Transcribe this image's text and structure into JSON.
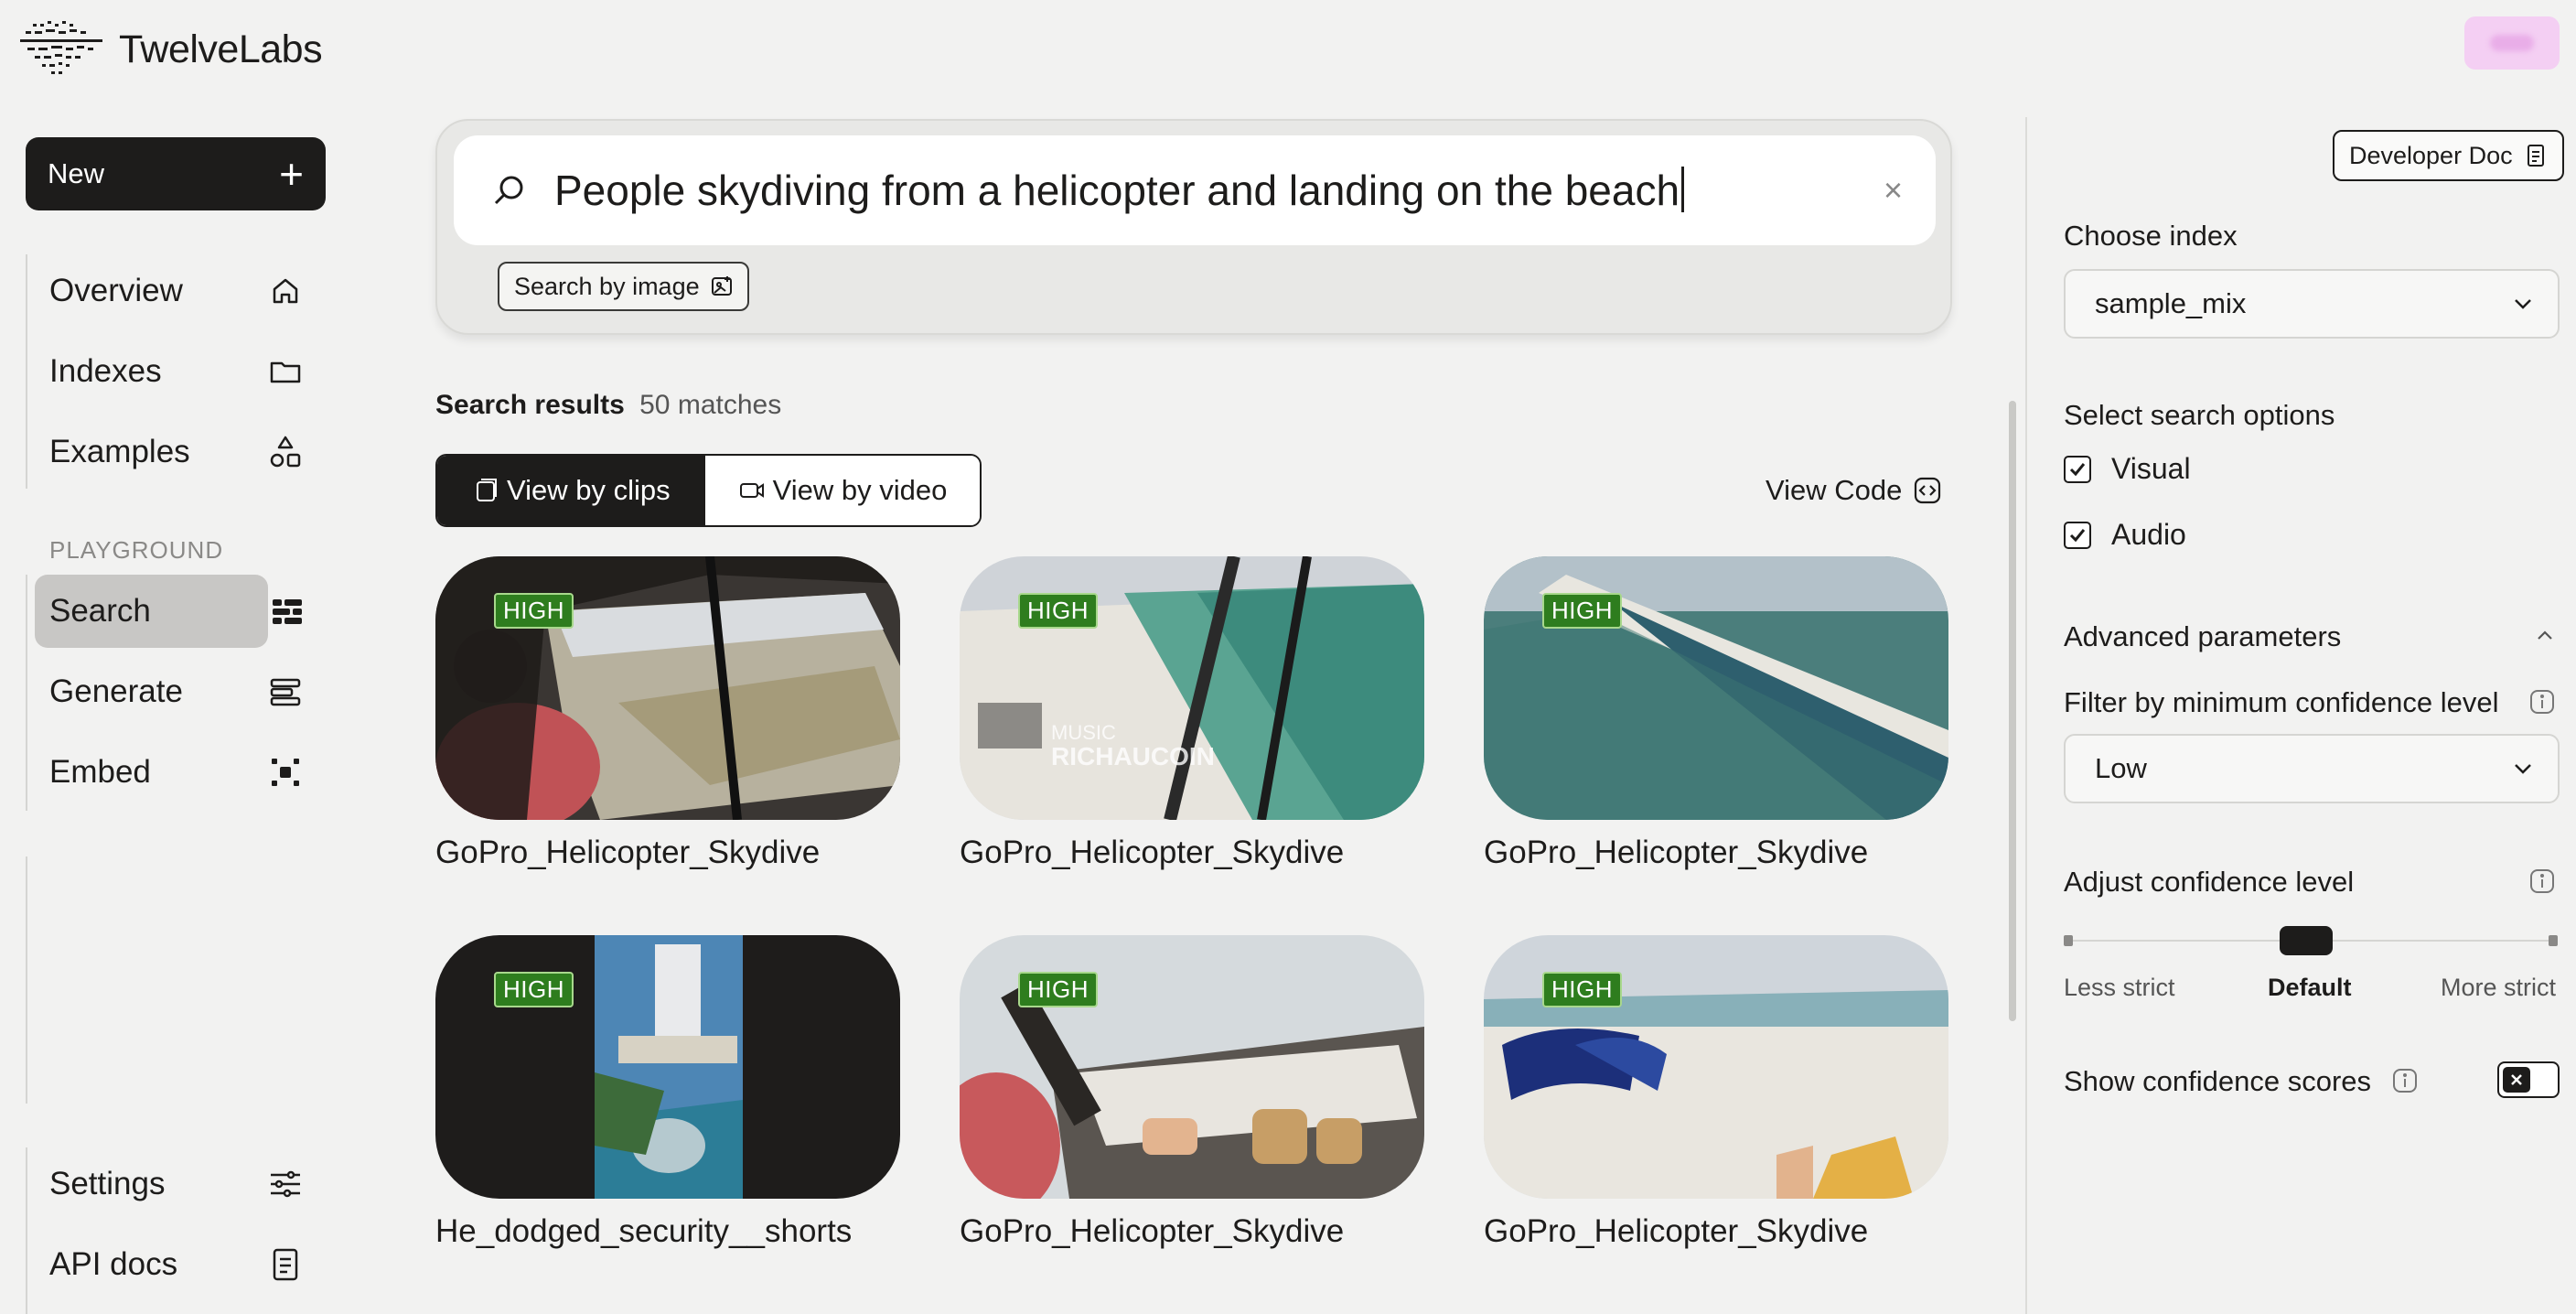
{
  "app": {
    "brand": "TwelveLabs"
  },
  "sidebar": {
    "new_label": "New",
    "items": [
      {
        "label": "Overview",
        "icon": "home-icon"
      },
      {
        "label": "Indexes",
        "icon": "folder-icon"
      },
      {
        "label": "Examples",
        "icon": "shapes-icon"
      }
    ],
    "playground_label": "PLAYGROUND",
    "playground_items": [
      {
        "label": "Search",
        "icon": "search-grid-icon",
        "active": true
      },
      {
        "label": "Generate",
        "icon": "generate-icon"
      },
      {
        "label": "Embed",
        "icon": "embed-icon"
      }
    ],
    "bottom_items": [
      {
        "label": "Settings",
        "icon": "sliders-icon"
      },
      {
        "label": "API docs",
        "icon": "document-icon"
      }
    ]
  },
  "search": {
    "query": "People skydiving from a helicopter and landing on the beach",
    "search_by_image_label": "Search by image",
    "clear_symbol": "×"
  },
  "results": {
    "label": "Search results",
    "count": "50 matches",
    "view_by_clips": "View by clips",
    "view_by_video": "View by video",
    "view_code": "View Code",
    "cards": [
      {
        "title": "GoPro_Helicopter_Skydive",
        "badge": "HIGH"
      },
      {
        "title": "GoPro_Helicopter_Skydive",
        "badge": "HIGH",
        "overlay_line1": "MUSIC",
        "overlay_line2": "RICHAUCOIN"
      },
      {
        "title": "GoPro_Helicopter_Skydive",
        "badge": "HIGH"
      },
      {
        "title": "He_dodged_security__shorts",
        "badge": "HIGH"
      },
      {
        "title": "GoPro_Helicopter_Skydive",
        "badge": "HIGH"
      },
      {
        "title": "GoPro_Helicopter_Skydive",
        "badge": "HIGH"
      }
    ]
  },
  "panel": {
    "developer_doc": "Developer Doc",
    "choose_index_label": "Choose index",
    "index_value": "sample_mix",
    "search_options_label": "Select search options",
    "option_visual": "Visual",
    "option_audio": "Audio",
    "advanced_label": "Advanced parameters",
    "filter_label": "Filter by minimum confidence level",
    "filter_value": "Low",
    "adjust_label": "Adjust confidence level",
    "slider_less": "Less strict",
    "slider_default": "Default",
    "slider_more": "More strict",
    "show_scores_label": "Show confidence scores"
  },
  "colors": {
    "accent_dark": "#1d1c1b",
    "badge_green": "#2e7d1e",
    "background": "#f2f2f1"
  }
}
